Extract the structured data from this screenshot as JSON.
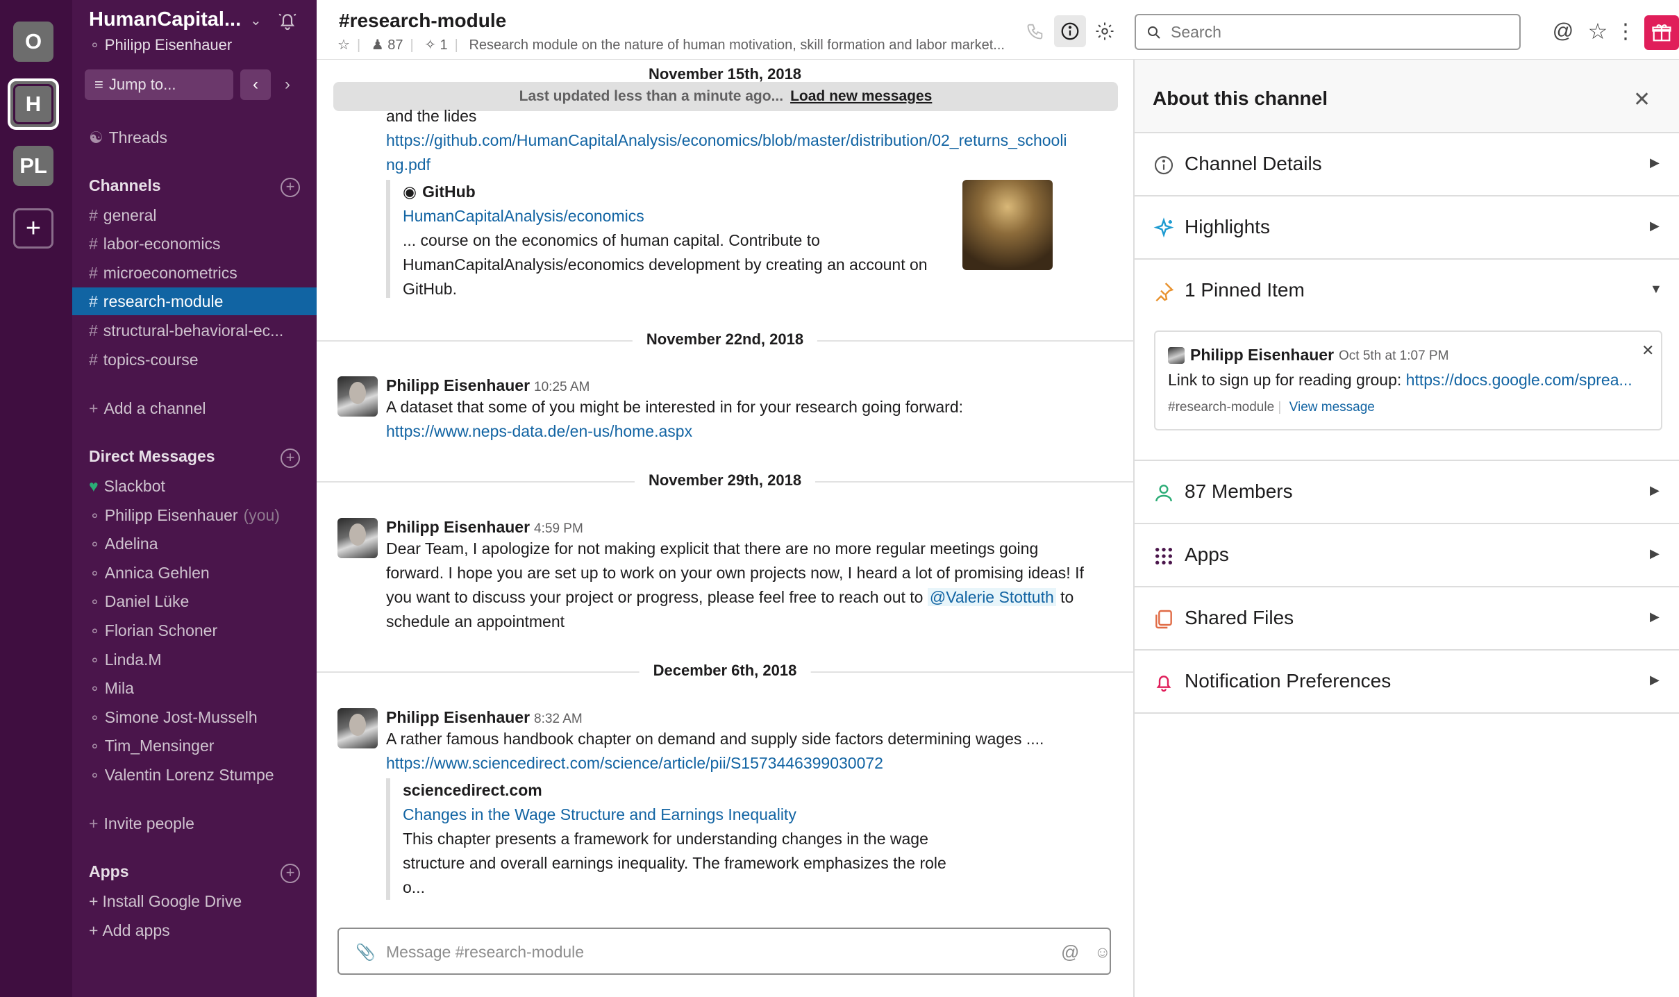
{
  "workspaces": [
    {
      "label": "O"
    },
    {
      "label": "H"
    },
    {
      "label": "PL"
    },
    {
      "label": "+"
    }
  ],
  "sidebar": {
    "team_name": "HumanCapital...",
    "user": "Philipp Eisenhauer",
    "jump_to": "Jump to...",
    "threads": "Threads",
    "channels_header": "Channels",
    "channels": [
      {
        "name": "general"
      },
      {
        "name": "labor-economics"
      },
      {
        "name": "microeconometrics"
      },
      {
        "name": "research-module"
      },
      {
        "name": "structural-behavioral-ec..."
      },
      {
        "name": "topics-course"
      }
    ],
    "add_channel": "Add a channel",
    "dm_header": "Direct Messages",
    "dms": [
      {
        "name": "Slackbot"
      },
      {
        "name": "Philipp Eisenhauer",
        "suffix": "(you)"
      },
      {
        "name": "Adelina"
      },
      {
        "name": "Annica Gehlen"
      },
      {
        "name": "Daniel Lüke"
      },
      {
        "name": "Florian Schoner"
      },
      {
        "name": "Linda.M"
      },
      {
        "name": "Mila"
      },
      {
        "name": "Simone Jost-Musselh"
      },
      {
        "name": "Tim_Mensinger"
      },
      {
        "name": "Valentin Lorenz Stumpe"
      }
    ],
    "invite_people": "Invite people",
    "apps_header": "Apps",
    "install_gdrive": "Install Google Drive",
    "add_apps": "Add apps",
    "colors": {
      "bg": "#4a154b",
      "active": "#1164a3"
    }
  },
  "header": {
    "channel": "#research-module",
    "members_count": "87",
    "pins_count": "1",
    "topic": "Research module on the nature of human motivation, skill formation and labor market...",
    "search_placeholder": "Search"
  },
  "messages": {
    "top_date": "November 15th, 2018",
    "banner_text": "Last updated less than a minute ago...",
    "banner_link": "Load new messages",
    "partial_text": "and the lides",
    "partial_link": "https://github.com/HumanCapitalAnalysis/economics/blob/master/distribution/02_returns_schooli",
    "partial_link_2": "ng.pdf",
    "unfurl1": {
      "site": "GitHub",
      "title": "HumanCapitalAnalysis/economics",
      "desc_1": "... course on the economics of human capital. Contribute to",
      "desc_2": "HumanCapitalAnalysis/economics development by creating an account on",
      "desc_3": "GitHub."
    },
    "date2": "November 22nd, 2018",
    "msg2": {
      "author": "Philipp Eisenhauer",
      "time": "10:25 AM",
      "text": "A dataset that some of you might be interested in for your research going forward:",
      "link": "https://www.neps-data.de/en-us/home.aspx"
    },
    "date3": "November 29th, 2018",
    "msg3": {
      "author": "Philipp Eisenhauer",
      "time": "4:59 PM",
      "line1": "Dear Team, I apologize for not making explicit that there are no more regular meetings going",
      "line2": "forward. I hope you are set up to work on your own projects now, I heard a lot of promising ideas! If",
      "line3_pre": "you want to discuss your project or progress, please feel free to reach out to",
      "mention": "@Valerie Stottuth",
      "line3_post": "to",
      "line4": "schedule an appointment"
    },
    "date4": "December 6th, 2018",
    "msg4": {
      "author": "Philipp Eisenhauer",
      "time": "8:32 AM",
      "text": "A rather famous handbook chapter on demand and supply side factors determining wages ....",
      "link": "https://www.sciencedirect.com/science/article/pii/S1573446399030072",
      "unfurl_site": "sciencedirect.com",
      "unfurl_title": "Changes in the Wage Structure and Earnings Inequality",
      "unfurl_1": "This chapter presents a framework for understanding changes in the wage",
      "unfurl_2": "structure and overall earnings inequality. The framework emphasizes the role",
      "unfurl_3": "o..."
    },
    "composer_placeholder": "Message #research-module"
  },
  "panel": {
    "title": "About this channel",
    "rows": {
      "details": "Channel Details",
      "highlights": "Highlights",
      "pinned": "1 Pinned Item",
      "members": "87 Members",
      "apps": "Apps",
      "files": "Shared Files",
      "notifications": "Notification Preferences"
    },
    "pinned_item": {
      "author": "Philipp Eisenhauer",
      "time": "Oct 5th at 1:07 PM",
      "text": "Link to sign up for reading group:",
      "link": "https://docs.google.com/sprea...",
      "channel": "#research-module",
      "view": "View message"
    }
  }
}
